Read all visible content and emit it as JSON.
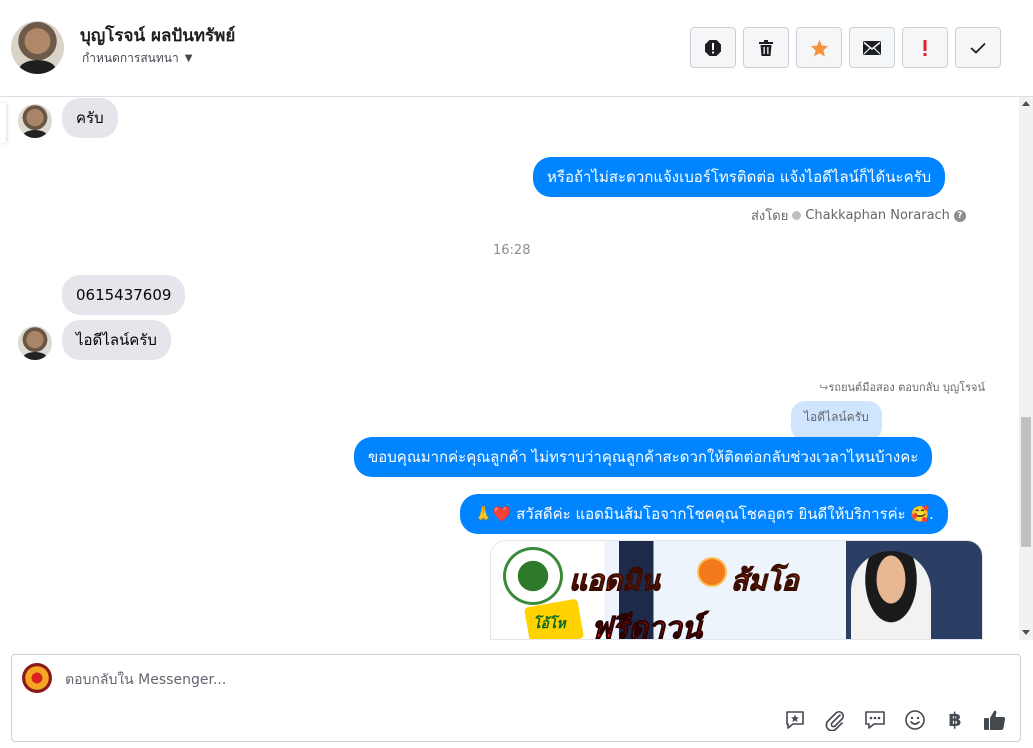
{
  "header": {
    "contact_name": "บุญโรจน์ ผลปันทรัพย์",
    "assign_label": "กำหนดการสนทนา",
    "toolbar": [
      {
        "name": "report-spam-icon",
        "symbol": "!"
      },
      {
        "name": "trash-icon",
        "symbol": "trash"
      },
      {
        "name": "star-icon",
        "symbol": "★"
      },
      {
        "name": "mail-icon",
        "symbol": "✉"
      },
      {
        "name": "important-icon",
        "symbol": "!"
      },
      {
        "name": "done-check-icon",
        "symbol": "✓"
      }
    ]
  },
  "messages": {
    "m1_text": "ครับ",
    "m2_text": "หรือถ้าไม่สะดวกแจ้งเบอร์โทรติดต่อ แจ้งไอดีไลน์ก็ได้นะครับ",
    "sent_by_prefix": "ส่งโดย",
    "sent_by_name": "Chakkaphan Norarach",
    "timestamp": "16:28",
    "m3_text": "0615437609",
    "m4_text": "ไอดีไลน์ครับ",
    "reply_label": "รถยนต์มือสอง ตอบกลับ บุญโรจน์",
    "quoted_text": "ไอดีไลน์ครับ",
    "m5_text": "ขอบคุณมากค่ะคุณลูกค้า ไม่ทราบว่าคุณลูกค้าสะดวกให้ติดต่อกลับช่วงเวลาไหนบ้างคะ",
    "m6_text": "🙏❤️ สวัสดีค่ะ แอดมินส้มโอจากโชคคุณโชคอุดร ยินดีให้บริการค่ะ 🥰.",
    "promo": {
      "title_1": "แอดมิน",
      "title_2": "ส้มโอ",
      "badge": "โอ้โห",
      "title_3": "ฟรีดาวน์"
    }
  },
  "composer": {
    "placeholder": "ตอบกลับใน Messenger...",
    "icons": [
      "saved-reply-icon",
      "attachment-icon",
      "quick-reply-icon",
      "emoji-icon",
      "baht-payment-icon",
      "like-icon"
    ]
  },
  "colors": {
    "outgoing_bubble": "#0084ff",
    "incoming_bubble": "#e4e6eb",
    "quoted_bubble": "#cfe5fd",
    "star": "#f7923a",
    "important": "#e4212a"
  }
}
